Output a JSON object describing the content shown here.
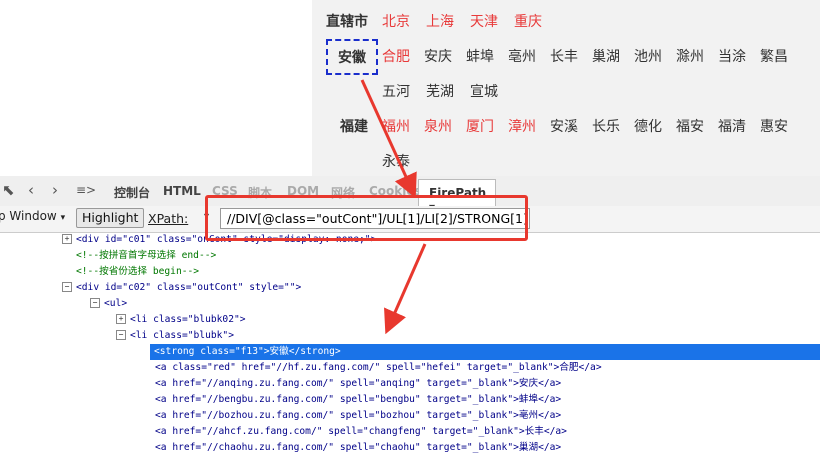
{
  "city_panel": {
    "rows": [
      {
        "province": "直辖市",
        "cities": [
          {
            "name": "北京",
            "red": true
          },
          {
            "name": "上海",
            "red": true
          },
          {
            "name": "天津",
            "red": true
          },
          {
            "name": "重庆",
            "red": true
          }
        ]
      },
      {
        "province": "安徽",
        "cities": [
          {
            "name": "合肥",
            "red": true
          },
          {
            "name": "安庆",
            "red": false
          },
          {
            "name": "蚌埠",
            "red": false
          },
          {
            "name": "亳州",
            "red": false
          },
          {
            "name": "长丰",
            "red": false
          },
          {
            "name": "巢湖",
            "red": false
          },
          {
            "name": "池州",
            "red": false
          },
          {
            "name": "滁州",
            "red": false
          },
          {
            "name": "当涂",
            "red": false
          },
          {
            "name": "繁昌",
            "red": false
          }
        ]
      },
      {
        "province": "",
        "cities": [
          {
            "name": "五河",
            "red": false
          },
          {
            "name": "芜湖",
            "red": false
          },
          {
            "name": "宣城",
            "red": false
          }
        ]
      },
      {
        "province": "福建",
        "cities": [
          {
            "name": "福州",
            "red": true
          },
          {
            "name": "泉州",
            "red": true
          },
          {
            "name": "厦门",
            "red": true
          },
          {
            "name": "漳州",
            "red": true
          },
          {
            "name": "安溪",
            "red": false
          },
          {
            "name": "长乐",
            "red": false
          },
          {
            "name": "德化",
            "red": false
          },
          {
            "name": "福安",
            "red": false
          },
          {
            "name": "福清",
            "red": false
          },
          {
            "name": "惠安",
            "red": false
          }
        ]
      },
      {
        "province": "",
        "cities": [
          {
            "name": "永泰",
            "red": false
          }
        ]
      }
    ]
  },
  "devtools": {
    "tabs": [
      "控制台",
      "HTML",
      "CSS",
      "脚本",
      "DOM",
      "网络",
      "Cookies"
    ],
    "active_tab": "FirePath",
    "window_select": "p Window",
    "highlight_label": "Highlight",
    "xpath_label": "XPath:",
    "xpath_value": "//DIV[@class=\"outCont\"]/UL[1]/LI[2]/STRONG[1]"
  },
  "code_lines": {
    "l1": "<div  id=\"c01\"  class=\"onCont\"  style=\"display: none;\">",
    "l2": "<!--按拼音首字母选择 end-->",
    "l3": "<!--按省份选择 begin-->",
    "l4": "<div  id=\"c02\"  class=\"outCont\"  style=\"\">",
    "l5": "<ul>",
    "l6": "<li  class=\"blubk02\">",
    "l7": "<li  class=\"blubk\">",
    "l8": "<strong  class=\"f13\">安徽</strong>",
    "l9": "<a  class=\"red\"  href=\"//hf.zu.fang.com/\"  spell=\"hefei\"  target=\"_blank\">合肥</a>",
    "l10": "<a  href=\"//anqing.zu.fang.com/\"  spell=\"anqing\"  target=\"_blank\">安庆</a>",
    "l11": "<a  href=\"//bengbu.zu.fang.com/\"  spell=\"bengbu\"  target=\"_blank\">蚌埠</a>",
    "l12": "<a  href=\"//bozhou.zu.fang.com/\"  spell=\"bozhou\"  target=\"_blank\">亳州</a>",
    "l13": "<a  href=\"//ahcf.zu.fang.com/\"  spell=\"changfeng\"  target=\"_blank\">长丰</a>",
    "l14": "<a  href=\"//chaohu.zu.fang.com/\"  spell=\"chaohu\"  target=\"_blank\">巢湖</a>"
  },
  "colors": {
    "red_city": "#e83a3a",
    "selection": "#1a73e8",
    "annotation": "#e8382e",
    "dashed_box": "#1a2ecc"
  }
}
